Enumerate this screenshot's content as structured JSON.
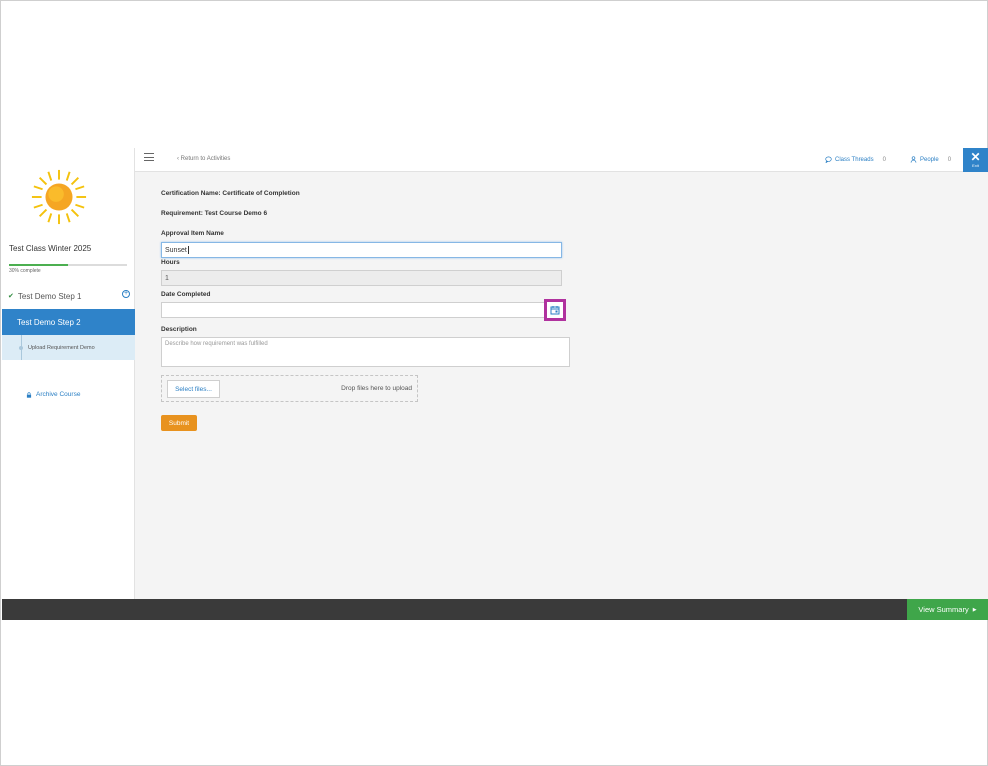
{
  "sidebar": {
    "class_title": "Test Class Winter 2025",
    "progress_text": "30% complete",
    "progress_fraction": 0.5,
    "steps": [
      {
        "label": "Test Demo Step 1",
        "completed": true
      },
      {
        "label": "Test Demo Step 2",
        "active": true
      }
    ],
    "substep": "Upload Requirement Demo",
    "archive_label": "Archive Course"
  },
  "topbar": {
    "return_label": "Return to Activities",
    "threads_label": "Class Threads",
    "threads_count": "0",
    "people_label": "People",
    "people_count": "0",
    "exit_label": "Exit"
  },
  "form": {
    "certification": "Certification Name: Certificate of Completion",
    "requirement": "Requirement: Test Course Demo 6",
    "approval_label": "Approval Item Name",
    "approval_value": "Sunset",
    "hours_label": "Hours",
    "hours_value": "1",
    "date_label": "Date Completed",
    "date_value": "",
    "description_label": "Description",
    "description_placeholder": "Describe how requirement was fulfilled",
    "select_files": "Select files...",
    "drop_text": "Drop files here to upload",
    "submit": "Submit"
  },
  "footer": {
    "summary_label": "View Summary"
  },
  "colors": {
    "accent_blue": "#2f83c9",
    "submit_orange": "#e8921e",
    "summary_green": "#3fa64a",
    "highlight_magenta": "#b0329e"
  }
}
